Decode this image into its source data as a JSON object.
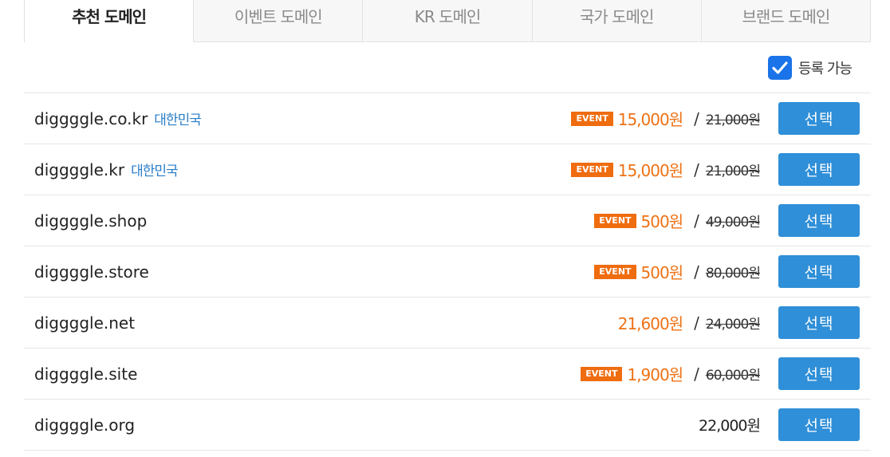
{
  "tabs": [
    {
      "label": "추천 도메인",
      "active": true
    },
    {
      "label": "이벤트 도메인",
      "active": false
    },
    {
      "label": "KR 도메인",
      "active": false
    },
    {
      "label": "국가 도메인",
      "active": false
    },
    {
      "label": "브랜드 도메인",
      "active": false
    }
  ],
  "filter": {
    "label": "등록 가능",
    "checked": true,
    "icon": "check-icon"
  },
  "badge_label": "EVENT",
  "colors": {
    "accent": "#2f8fd8",
    "sale": "#ee7215",
    "badge": "#ef6c0f",
    "country": "#2a7ec7",
    "checkbox": "#1a73e8"
  },
  "rows": [
    {
      "domain": "diggggle.co.kr",
      "country": "대한민국",
      "event": true,
      "price": "15,000원",
      "slash": "/",
      "original": "21,000원",
      "button": "선택"
    },
    {
      "domain": "diggggle.kr",
      "country": "대한민국",
      "event": true,
      "price": "15,000원",
      "slash": "/",
      "original": "21,000원",
      "button": "선택"
    },
    {
      "domain": "diggggle.shop",
      "country": "",
      "event": true,
      "price": "500원",
      "slash": "/",
      "original": "49,000원",
      "button": "선택"
    },
    {
      "domain": "diggggle.store",
      "country": "",
      "event": true,
      "price": "500원",
      "slash": "/",
      "original": "80,000원",
      "button": "선택"
    },
    {
      "domain": "diggggle.net",
      "country": "",
      "event": false,
      "price": "21,600원",
      "slash": "/",
      "original": "24,000원",
      "button": "선택"
    },
    {
      "domain": "diggggle.site",
      "country": "",
      "event": true,
      "price": "1,900원",
      "slash": "/",
      "original": "60,000원",
      "button": "선택"
    },
    {
      "domain": "diggggle.org",
      "country": "",
      "event": false,
      "price": "22,000원",
      "slash": "",
      "original": "",
      "button": "선택",
      "plain": true
    }
  ]
}
